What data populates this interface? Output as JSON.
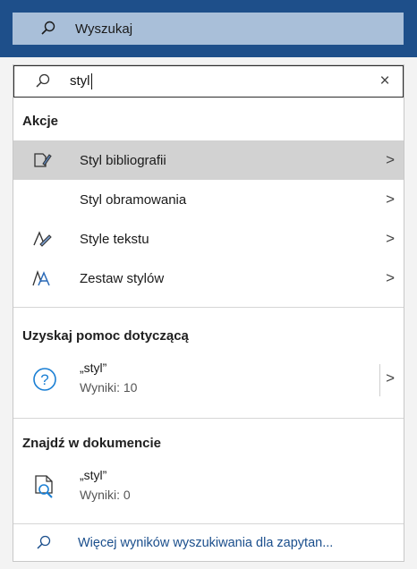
{
  "top_search": {
    "label": "Wyszukaj",
    "icon": "search-icon"
  },
  "query": {
    "value": "styl",
    "clear_icon": "close-icon",
    "clear_glyph": "×"
  },
  "actions": {
    "title": "Akcje",
    "items": [
      {
        "label": "Styl bibliografii",
        "icon": "bibliography-style-icon",
        "chevron": ">",
        "highlighted": true
      },
      {
        "label": "Styl obramowania",
        "icon": "",
        "chevron": ">"
      },
      {
        "label": "Style tekstu",
        "icon": "text-styles-brush-icon",
        "chevron": ">"
      },
      {
        "label": "Zestaw stylów",
        "icon": "style-set-icon",
        "chevron": ">"
      }
    ]
  },
  "help": {
    "title": "Uzyskaj pomoc dotyczącą",
    "result": {
      "query": "„styl”",
      "count": "Wyniki: 10",
      "icon": "help-question-icon",
      "chevron": ">"
    }
  },
  "find": {
    "title": "Znajdź w dokumencie",
    "result": {
      "query": "„styl”",
      "count": "Wyniki: 0",
      "icon": "document-search-icon"
    }
  },
  "more_results": {
    "label": "Więcej wyników wyszukiwania dla zapytan...",
    "icon": "search-icon"
  },
  "colors": {
    "titlebar": "#1e4f8a",
    "search_box": "#a9bfd9",
    "highlight": "#d2d2d2",
    "help_icon": "#1a7fd4",
    "link": "#1a4e8c"
  }
}
